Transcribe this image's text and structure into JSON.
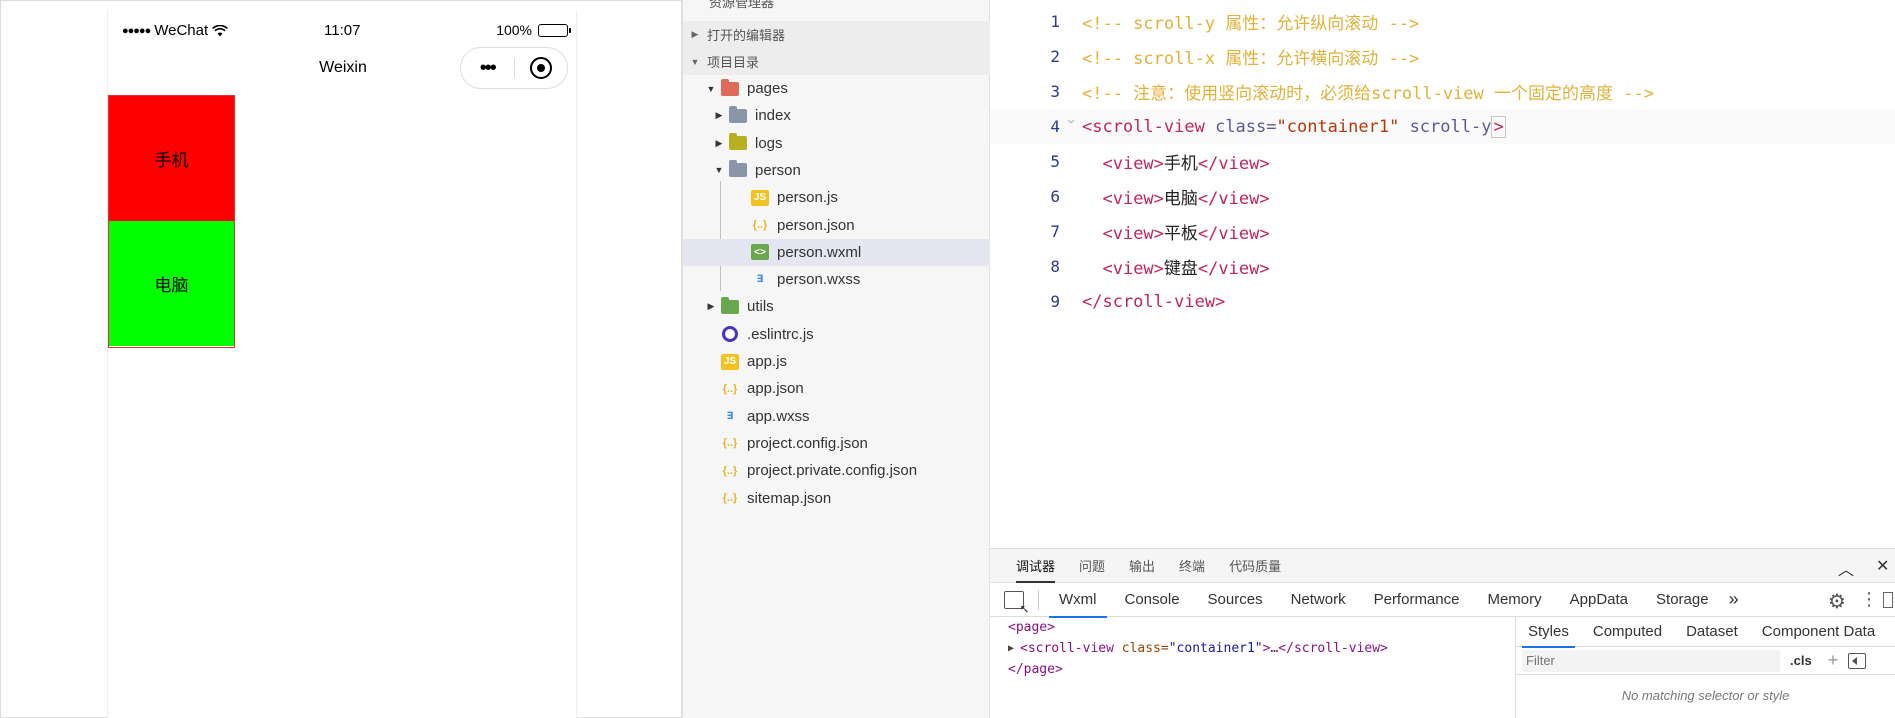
{
  "simulator": {
    "status_bar": {
      "signal_dots": "●●●●●",
      "carrier": "WeChat",
      "time": "11:07",
      "battery_text": "100%",
      "battery_level": 1.0
    },
    "nav_title": "Weixin",
    "capsule": {
      "more": "•••"
    },
    "scroll_view_items": [
      {
        "label": "手机",
        "color": "#ff0000"
      },
      {
        "label": "电脑",
        "color": "#00ff00"
      }
    ]
  },
  "explorer": {
    "top_clip": "资源管理器",
    "sections": {
      "open_editors": "打开的编辑器",
      "project_dir": "项目目录"
    },
    "tree": [
      {
        "label": "pages",
        "type": "folder-open",
        "color": "#e06a5a"
      },
      {
        "label": "index",
        "type": "folder",
        "color": "#8a96a8"
      },
      {
        "label": "logs",
        "type": "folder",
        "color": "#b8b020"
      },
      {
        "label": "person",
        "type": "folder-open",
        "color": "#8a96a8"
      },
      {
        "label": "person.js",
        "type": "js"
      },
      {
        "label": "person.json",
        "type": "json"
      },
      {
        "label": "person.wxml",
        "type": "wxml"
      },
      {
        "label": "person.wxss",
        "type": "wxss"
      },
      {
        "label": "utils",
        "type": "folder",
        "color": "#6aa84f"
      },
      {
        "label": ".eslintrc.js",
        "type": "eslint"
      },
      {
        "label": "app.js",
        "type": "js"
      },
      {
        "label": "app.json",
        "type": "json"
      },
      {
        "label": "app.wxss",
        "type": "wxss"
      },
      {
        "label": "project.config.json",
        "type": "json"
      },
      {
        "label": "project.private.config.json",
        "type": "json"
      },
      {
        "label": "sitemap.json",
        "type": "json"
      }
    ]
  },
  "editor": {
    "lines": [
      {
        "num": "1",
        "comment": "<!-- scroll-y 属性：允许纵向滚动 -->"
      },
      {
        "num": "2",
        "comment": "<!-- scroll-x 属性：允许横向滚动 -->"
      },
      {
        "num": "3",
        "comment": "<!-- 注意：使用竖向滚动时，必须给scroll-view 一个固定的高度 -->"
      },
      {
        "num": "4",
        "open_lt": "<",
        "tag": "scroll-view",
        "attr1": " class=",
        "val1": "\"container1\"",
        "attr2": " scroll-y",
        "close_gt": ">"
      },
      {
        "num": "5",
        "open": "<view>",
        "text": "手机",
        "close": "</view>"
      },
      {
        "num": "6",
        "open": "<view>",
        "text": "电脑",
        "close": "</view>"
      },
      {
        "num": "7",
        "open": "<view>",
        "text": "平板",
        "close": "</view>"
      },
      {
        "num": "8",
        "open": "<view>",
        "text": "键盘",
        "close": "</view>"
      },
      {
        "num": "9",
        "tag_close": "</scroll-view>"
      }
    ]
  },
  "devtools": {
    "top_tabs": [
      "调试器",
      "问题",
      "输出",
      "终端",
      "代码质量"
    ],
    "collapse": "︿",
    "close": "✕",
    "panel_tabs": [
      "Wxml",
      "Console",
      "Sources",
      "Network",
      "Performance",
      "Memory",
      "AppData",
      "Storage"
    ],
    "overflow": "»",
    "wxml": {
      "page_open": "<page>",
      "sv_open": "<scroll-view",
      "sv_attr": " class=",
      "sv_val": "\"container1\"",
      "sv_rest": ">…</scroll-view>",
      "page_close": "</page>"
    },
    "styles_tabs": [
      "Styles",
      "Computed",
      "Dataset",
      "Component Data"
    ],
    "filter_placeholder": "Filter",
    "cls": ".cls",
    "plus": "+",
    "no_match": "No matching selector or style"
  }
}
